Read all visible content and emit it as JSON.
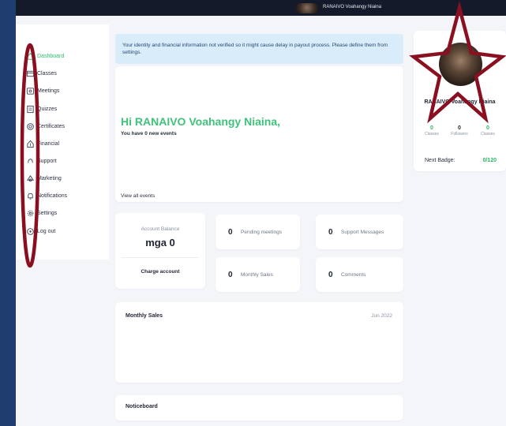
{
  "topbar": {
    "username": "RANAIVO Voahangy Niaina"
  },
  "sidebar": {
    "items": [
      {
        "label": "Dashboard",
        "icon": "dashboard-icon",
        "active": true
      },
      {
        "label": "Classes",
        "icon": "classes-icon"
      },
      {
        "label": "Meetings",
        "icon": "meetings-icon"
      },
      {
        "label": "Quizzes",
        "icon": "quizzes-icon"
      },
      {
        "label": "Certificates",
        "icon": "certificates-icon"
      },
      {
        "label": "Financial",
        "icon": "financial-icon"
      },
      {
        "label": "Support",
        "icon": "support-icon"
      },
      {
        "label": "Marketing",
        "icon": "marketing-icon"
      },
      {
        "label": "Notifications",
        "icon": "bell-icon"
      },
      {
        "label": "Settings",
        "icon": "gear-icon"
      },
      {
        "label": "Log out",
        "icon": "logout-icon"
      }
    ]
  },
  "alert": {
    "text": "Your identity and financial information not verified so it might cause delay in payout process. Please define them from settings."
  },
  "greeting": {
    "title": "Hi RANAIVO Voahangy Niaina,",
    "subtitle": "You have 0 new events",
    "link": "View all events"
  },
  "balance": {
    "label": "Account Balance",
    "value": "mga 0",
    "button": "Charge account"
  },
  "stats": {
    "pending_meetings": {
      "value": "0",
      "label": "Pending meetings"
    },
    "support_messages": {
      "value": "0",
      "label": "Support Messages"
    },
    "monthly_sales": {
      "value": "0",
      "label": "Monthly Sales"
    },
    "comments": {
      "value": "0",
      "label": "Comments"
    }
  },
  "monthly_sales_card": {
    "title": "Monthly Sales",
    "date": "Jun 2022"
  },
  "noticeboard": {
    "title": "Noticeboard"
  },
  "profile": {
    "name": "RANAIVO Voahangy Niaina",
    "classes": {
      "value": "0",
      "label": "Classes"
    },
    "followers": {
      "value": "0",
      "label": "Followers"
    },
    "orders": {
      "value": "0",
      "label": "Classes"
    },
    "badge_label": "Next Badge:",
    "badge_value": "0/120"
  },
  "colors": {
    "accent": "#27c16b",
    "annotation": "#8a0f20",
    "background": "#1f3d6e",
    "alert_bg": "#d9ecfa"
  }
}
